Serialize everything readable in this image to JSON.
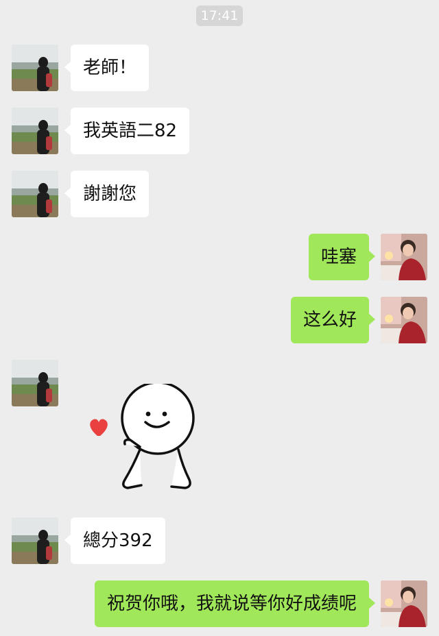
{
  "status": {
    "time": "17:41"
  },
  "messages": [
    {
      "side": "in",
      "text": "老師！"
    },
    {
      "side": "in",
      "text": "我英語二82"
    },
    {
      "side": "in",
      "text": "謝謝您"
    },
    {
      "side": "out",
      "text": "哇塞"
    },
    {
      "side": "out",
      "text": "这么好"
    },
    {
      "side": "in",
      "type": "sticker",
      "sticker": "smiley-heart-sticker"
    },
    {
      "side": "in",
      "text": "總分392"
    },
    {
      "side": "out",
      "text": "祝贺你哦，我就说等你好成绩呢"
    }
  ],
  "colors": {
    "background": "#ededed",
    "incoming_bubble": "#ffffff",
    "outgoing_bubble": "#a0e75a",
    "timestamp_bg": "#d6d6d6",
    "heart": "#e8413f"
  }
}
